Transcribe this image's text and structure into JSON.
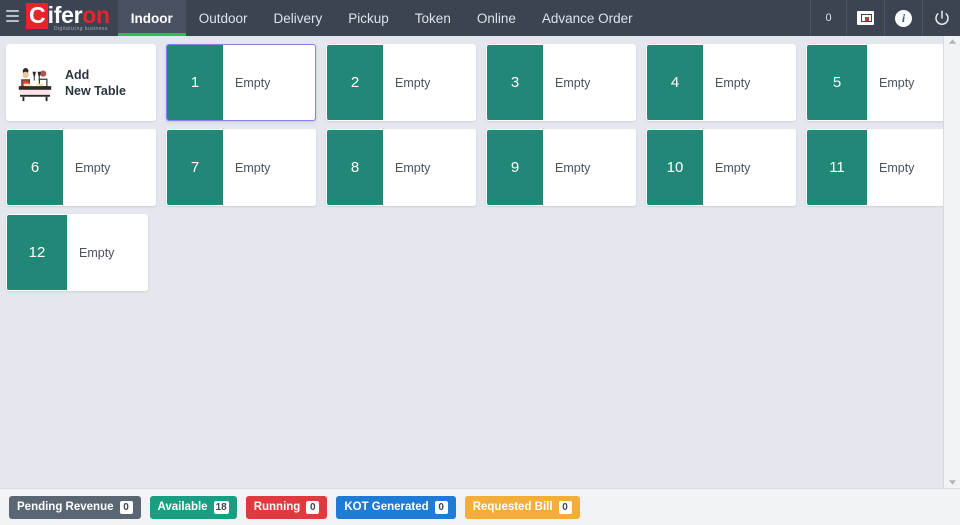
{
  "header": {
    "menu_icon": "hamburger-icon",
    "logo": {
      "letter_c": "C",
      "mid": "ifer",
      "tail": "on",
      "tagline": "Digitalizing business"
    },
    "tabs": [
      {
        "label": "Indoor",
        "active": true
      },
      {
        "label": "Outdoor",
        "active": false
      },
      {
        "label": "Delivery",
        "active": false
      },
      {
        "label": "Pickup",
        "active": false
      },
      {
        "label": "Token",
        "active": false
      },
      {
        "label": "Online",
        "active": false
      },
      {
        "label": "Advance Order",
        "active": false
      }
    ],
    "right_actions": {
      "counter_value": "0",
      "customer_display_icon": "monitor-screen-icon",
      "info_icon": "info-icon",
      "power_icon": "power-icon"
    },
    "colors": {
      "bar_bg": "#3c4452",
      "active_tab_bg": "#4a5262",
      "active_underline": "#27c24c",
      "logo_red": "#e8232a"
    }
  },
  "main": {
    "add_card": {
      "icon": "dining-table-people-icon",
      "line1": "Add",
      "line2": "New Table"
    },
    "status_empty": "Empty",
    "table_color": "#218878",
    "selected_border_color": "#8b7ff0",
    "tables": [
      {
        "number": "1",
        "status": "Empty",
        "selected": true
      },
      {
        "number": "2",
        "status": "Empty",
        "selected": false
      },
      {
        "number": "3",
        "status": "Empty",
        "selected": false
      },
      {
        "number": "4",
        "status": "Empty",
        "selected": false
      },
      {
        "number": "5",
        "status": "Empty",
        "selected": false
      },
      {
        "number": "6",
        "status": "Empty",
        "selected": false
      },
      {
        "number": "7",
        "status": "Empty",
        "selected": false
      },
      {
        "number": "8",
        "status": "Empty",
        "selected": false
      },
      {
        "number": "9",
        "status": "Empty",
        "selected": false
      },
      {
        "number": "10",
        "status": "Empty",
        "selected": false
      },
      {
        "number": "11",
        "status": "Empty",
        "selected": false
      },
      {
        "number": "12",
        "status": "Empty",
        "selected": false
      }
    ],
    "scrollbar": {
      "up_icon": "scroll-up-arrow-icon",
      "down_icon": "scroll-down-arrow-icon"
    }
  },
  "footer": {
    "badges": [
      {
        "label": "Pending Revenue",
        "count": "0",
        "color": "#5a6673"
      },
      {
        "label": "Available",
        "count": "18",
        "color": "#1a9e82"
      },
      {
        "label": "Running",
        "count": "0",
        "color": "#e0393e"
      },
      {
        "label": "KOT Generated",
        "count": "0",
        "color": "#1f7bd6"
      },
      {
        "label": "Requested Bill",
        "count": "0",
        "color": "#f3ad39"
      }
    ]
  }
}
